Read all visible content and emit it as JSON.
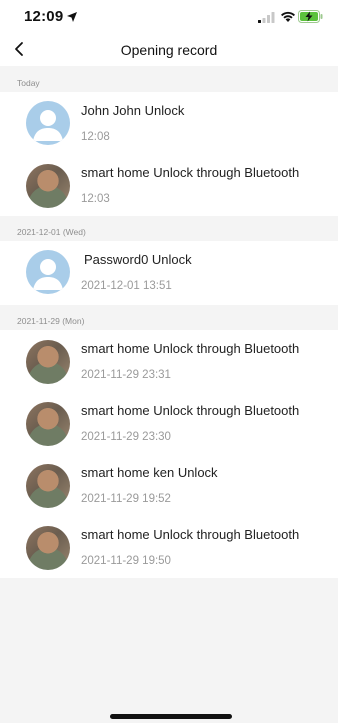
{
  "status_bar": {
    "time": "12:09"
  },
  "header": {
    "title": "Opening record"
  },
  "sections": [
    {
      "label": "Today",
      "records": [
        {
          "title": "John John Unlock",
          "time": "12:08",
          "avatar": "default-user-icon"
        },
        {
          "title": "smart home Unlock through Bluetooth",
          "time": "12:03",
          "avatar": "user-photo"
        }
      ]
    },
    {
      "label": "2021-12-01 (Wed)",
      "records": [
        {
          "title": "Password0 Unlock",
          "time": "2021-12-01 13:51",
          "avatar": "default-user-icon"
        }
      ]
    },
    {
      "label": "2021-11-29 (Mon)",
      "records": [
        {
          "title": "smart home Unlock through Bluetooth",
          "time": "2021-11-29 23:31",
          "avatar": "user-photo"
        },
        {
          "title": "smart home Unlock through Bluetooth",
          "time": "2021-11-29 23:30",
          "avatar": "user-photo"
        },
        {
          "title": "smart home ken Unlock",
          "time": "2021-11-29 19:52",
          "avatar": "user-photo"
        },
        {
          "title": "smart home Unlock through Bluetooth",
          "time": "2021-11-29 19:50",
          "avatar": "user-photo"
        }
      ]
    }
  ],
  "colors": {
    "background": "#f4f4f4",
    "avatar_default": "#a9cde9",
    "secondary_text": "#9a9a9a"
  }
}
